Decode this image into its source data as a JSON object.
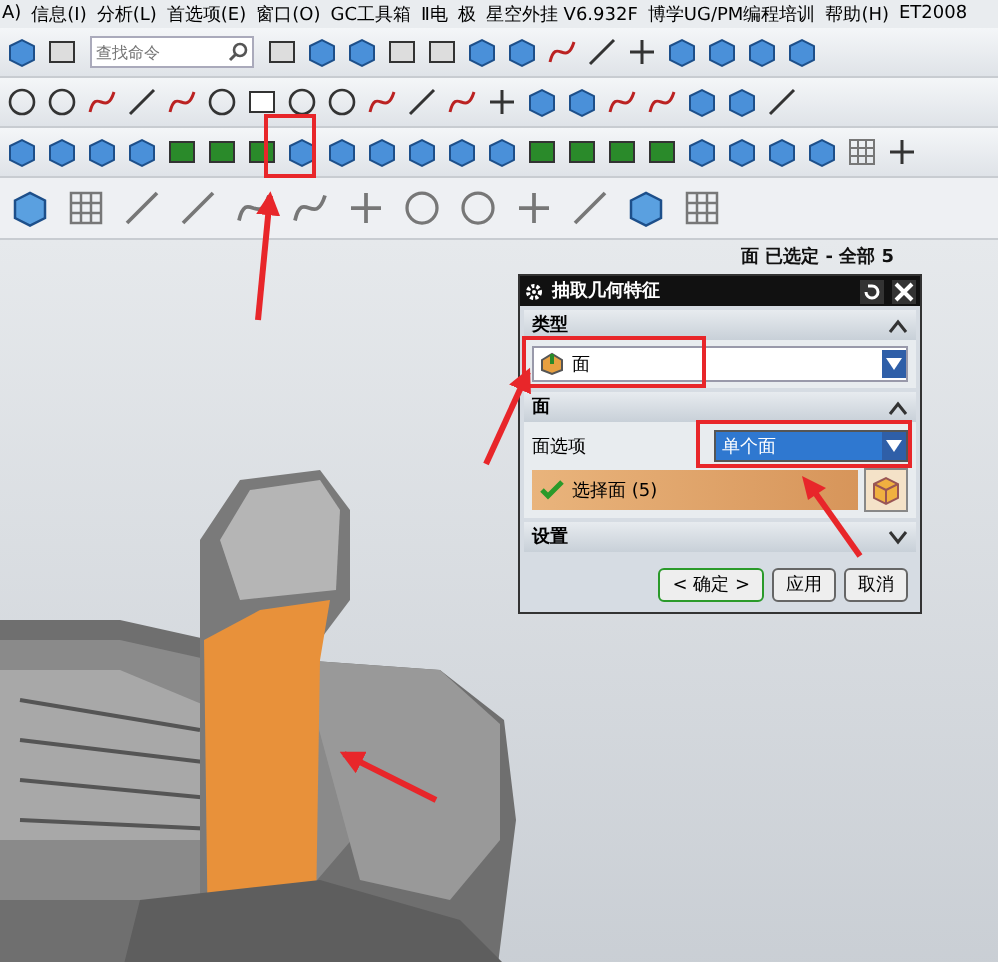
{
  "menu_bar": [
    "A)",
    "信息(I)",
    "分析(L)",
    "首选项(E)",
    "窗口(O)",
    "GC工具箱",
    "Ⅱ电",
    "极",
    "星空外挂 V6.932F",
    "博学UG/PM编程培训",
    "帮助(H)",
    "ET2008"
  ],
  "search": {
    "placeholder": "查找命令"
  },
  "status": "面 已选定 - 全部 5",
  "dialog": {
    "title": "抽取几何特征",
    "sections": [
      {
        "kind": "type",
        "title": "类型",
        "expanded": true,
        "value": "面"
      },
      {
        "kind": "face",
        "title": "面",
        "expanded": true,
        "option_label": "面选项",
        "option_value": "单个面",
        "selection": "选择面 (5)",
        "done": true
      },
      {
        "kind": "settings",
        "title": "设置",
        "expanded": false
      }
    ],
    "buttons": [
      {
        "label": "< 确定 >",
        "default": true
      },
      {
        "label": "应用",
        "default": false
      },
      {
        "label": "取消",
        "default": false
      }
    ]
  }
}
